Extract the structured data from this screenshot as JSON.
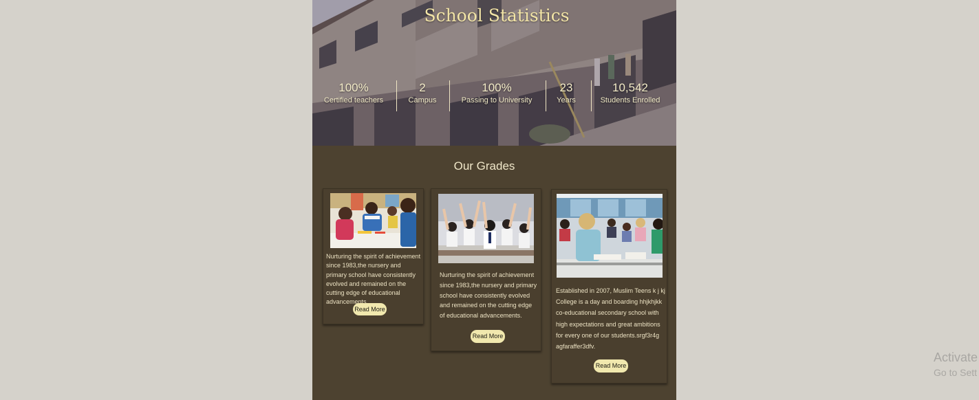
{
  "hero": {
    "title": "School Statistics",
    "stats": [
      {
        "value": "100%",
        "label": "Certified teachers"
      },
      {
        "value": "2",
        "label": "Campus"
      },
      {
        "value": "100%",
        "label": "Passing to University"
      },
      {
        "value": "23",
        "label": "Years"
      },
      {
        "value": "10,542",
        "label": "Students Enrolled"
      }
    ]
  },
  "grades": {
    "title": "Our Grades",
    "cards": [
      {
        "text": "Nurturing the spirit of achievement since 1983,the nursery and primary school have consistently evolved and remained on the cutting edge of educational advancements.",
        "button": "Read More"
      },
      {
        "text": "Nurturing the spirit of achievement since 1983,the nursery and primary school have consistently evolved and remained on the cutting edge of educational advancements.",
        "button": "Read More"
      },
      {
        "text": "Established in 2007, Muslim Teens k j kj College is a day and boarding  hhjkhjkk co-educational secondary school with high expectations and great ambitions for every one of our students.srgf3r4g agfaraffer3dfv.",
        "button": "Read More"
      }
    ]
  },
  "watermark": {
    "line1": "Activate",
    "line2": "Go to Sett"
  },
  "colors": {
    "page_bg": "#4d4230",
    "desktop_bg": "#d5d2cb",
    "accent_gold": "#f2e4a6",
    "button_bg": "#f1e8ae"
  }
}
